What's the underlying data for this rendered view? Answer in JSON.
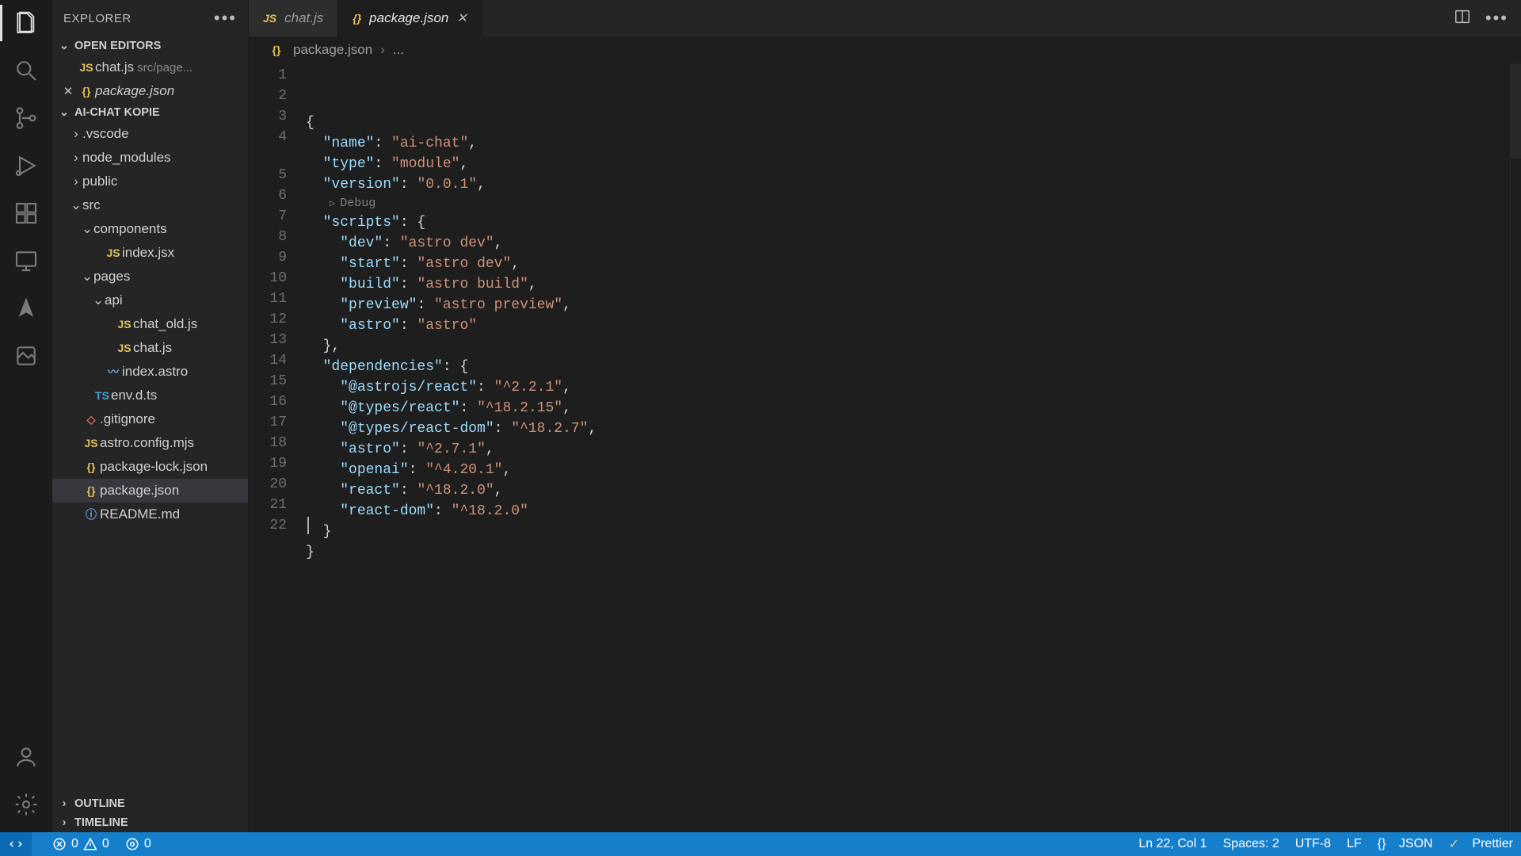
{
  "sidebar": {
    "title": "EXPLORER",
    "sections": {
      "open_editors": "OPEN EDITORS",
      "project": "AI-CHAT KOPIE",
      "outline": "OUTLINE",
      "timeline": "TIMELINE"
    },
    "open_editors_items": [
      {
        "icon": "JS",
        "name": "chat.js",
        "hint": "src/page..."
      },
      {
        "icon": "{}",
        "name": "package.json",
        "closable": true
      }
    ],
    "tree": [
      {
        "depth": 0,
        "chev": "›",
        "name": ".vscode"
      },
      {
        "depth": 0,
        "chev": "›",
        "name": "node_modules"
      },
      {
        "depth": 0,
        "chev": "›",
        "name": "public"
      },
      {
        "depth": 0,
        "chev": "⌄",
        "name": "src"
      },
      {
        "depth": 1,
        "chev": "⌄",
        "name": "components"
      },
      {
        "depth": 2,
        "icon": "JS",
        "iconClass": "ico-js",
        "name": "index.jsx"
      },
      {
        "depth": 1,
        "chev": "⌄",
        "name": "pages"
      },
      {
        "depth": 2,
        "chev": "⌄",
        "name": "api"
      },
      {
        "depth": 3,
        "icon": "JS",
        "iconClass": "ico-js",
        "name": "chat_old.js"
      },
      {
        "depth": 3,
        "icon": "JS",
        "iconClass": "ico-js",
        "name": "chat.js"
      },
      {
        "depth": 2,
        "icon": "〰",
        "iconClass": "ico-md",
        "name": "index.astro"
      },
      {
        "depth": 1,
        "icon": "TS",
        "iconClass": "ico-ts",
        "name": "env.d.ts"
      },
      {
        "depth": 0,
        "icon": "◇",
        "iconClass": "ico-git",
        "name": ".gitignore"
      },
      {
        "depth": 0,
        "icon": "JS",
        "iconClass": "ico-js",
        "name": "astro.config.mjs"
      },
      {
        "depth": 0,
        "icon": "{}",
        "iconClass": "ico-json",
        "name": "package-lock.json"
      },
      {
        "depth": 0,
        "icon": "{}",
        "iconClass": "ico-json",
        "name": "package.json",
        "selected": true
      },
      {
        "depth": 0,
        "icon": "ⓘ",
        "iconClass": "ico-readme",
        "name": "README.md"
      }
    ]
  },
  "tabs": [
    {
      "icon": "JS",
      "iconClass": "ico-js",
      "label": "chat.js",
      "active": false
    },
    {
      "icon": "{}",
      "iconClass": "ico-json",
      "label": "package.json",
      "active": true,
      "close": true
    }
  ],
  "breadcrumbs": {
    "icon": "{}",
    "file": "package.json",
    "tail": "..."
  },
  "codelens": "Debug",
  "code_lines": [
    [
      [
        "punc",
        "{"
      ]
    ],
    [
      [
        "pad",
        "  "
      ],
      [
        "key",
        "\"name\""
      ],
      [
        "punc",
        ": "
      ],
      [
        "str",
        "\"ai-chat\""
      ],
      [
        "punc",
        ","
      ]
    ],
    [
      [
        "pad",
        "  "
      ],
      [
        "key",
        "\"type\""
      ],
      [
        "punc",
        ": "
      ],
      [
        "str",
        "\"module\""
      ],
      [
        "punc",
        ","
      ]
    ],
    [
      [
        "pad",
        "  "
      ],
      [
        "key",
        "\"version\""
      ],
      [
        "punc",
        ": "
      ],
      [
        "str",
        "\"0.0.1\""
      ],
      [
        "punc",
        ","
      ]
    ],
    [
      [
        "pad",
        "  "
      ],
      [
        "key",
        "\"scripts\""
      ],
      [
        "punc",
        ": {"
      ]
    ],
    [
      [
        "pad",
        "    "
      ],
      [
        "key",
        "\"dev\""
      ],
      [
        "punc",
        ": "
      ],
      [
        "str",
        "\"astro dev\""
      ],
      [
        "punc",
        ","
      ]
    ],
    [
      [
        "pad",
        "    "
      ],
      [
        "key",
        "\"start\""
      ],
      [
        "punc",
        ": "
      ],
      [
        "str",
        "\"astro dev\""
      ],
      [
        "punc",
        ","
      ]
    ],
    [
      [
        "pad",
        "    "
      ],
      [
        "key",
        "\"build\""
      ],
      [
        "punc",
        ": "
      ],
      [
        "str",
        "\"astro build\""
      ],
      [
        "punc",
        ","
      ]
    ],
    [
      [
        "pad",
        "    "
      ],
      [
        "key",
        "\"preview\""
      ],
      [
        "punc",
        ": "
      ],
      [
        "str",
        "\"astro preview\""
      ],
      [
        "punc",
        ","
      ]
    ],
    [
      [
        "pad",
        "    "
      ],
      [
        "key",
        "\"astro\""
      ],
      [
        "punc",
        ": "
      ],
      [
        "str",
        "\"astro\""
      ]
    ],
    [
      [
        "pad",
        "  "
      ],
      [
        "punc",
        "},"
      ]
    ],
    [
      [
        "pad",
        "  "
      ],
      [
        "key",
        "\"dependencies\""
      ],
      [
        "punc",
        ": {"
      ]
    ],
    [
      [
        "pad",
        "    "
      ],
      [
        "key",
        "\"@astrojs/react\""
      ],
      [
        "punc",
        ": "
      ],
      [
        "str",
        "\"^2.2.1\""
      ],
      [
        "punc",
        ","
      ]
    ],
    [
      [
        "pad",
        "    "
      ],
      [
        "key",
        "\"@types/react\""
      ],
      [
        "punc",
        ": "
      ],
      [
        "str",
        "\"^18.2.15\""
      ],
      [
        "punc",
        ","
      ]
    ],
    [
      [
        "pad",
        "    "
      ],
      [
        "key",
        "\"@types/react-dom\""
      ],
      [
        "punc",
        ": "
      ],
      [
        "str",
        "\"^18.2.7\""
      ],
      [
        "punc",
        ","
      ]
    ],
    [
      [
        "pad",
        "    "
      ],
      [
        "key",
        "\"astro\""
      ],
      [
        "punc",
        ": "
      ],
      [
        "str",
        "\"^2.7.1\""
      ],
      [
        "punc",
        ","
      ]
    ],
    [
      [
        "pad",
        "    "
      ],
      [
        "key",
        "\"openai\""
      ],
      [
        "punc",
        ": "
      ],
      [
        "str",
        "\"^4.20.1\""
      ],
      [
        "punc",
        ","
      ]
    ],
    [
      [
        "pad",
        "    "
      ],
      [
        "key",
        "\"react\""
      ],
      [
        "punc",
        ": "
      ],
      [
        "str",
        "\"^18.2.0\""
      ],
      [
        "punc",
        ","
      ]
    ],
    [
      [
        "pad",
        "    "
      ],
      [
        "key",
        "\"react-dom\""
      ],
      [
        "punc",
        ": "
      ],
      [
        "str",
        "\"^18.2.0\""
      ]
    ],
    [
      [
        "pad",
        "  "
      ],
      [
        "punc",
        "}"
      ]
    ],
    [
      [
        "punc",
        "}"
      ]
    ],
    [
      [
        "punc",
        ""
      ]
    ]
  ],
  "status": {
    "errors": "0",
    "warnings": "0",
    "ports": "0",
    "cursor": "Ln 22, Col 1",
    "spaces": "Spaces: 2",
    "encoding": "UTF-8",
    "eol": "LF",
    "lang_icon": "{}",
    "lang": "JSON",
    "formatter_icon": "✓",
    "formatter": "Prettier"
  }
}
